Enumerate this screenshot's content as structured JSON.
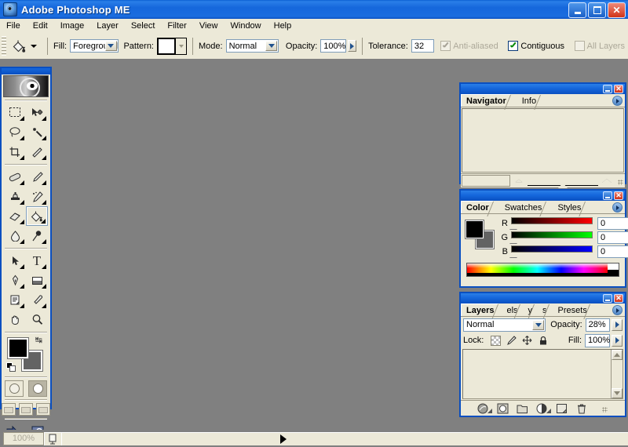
{
  "window": {
    "title": "Adobe Photoshop ME",
    "app_icon": "photoshop-icon",
    "buttons": {
      "minimize": "minimize-icon",
      "restore": "restore-icon",
      "close": "close-icon"
    }
  },
  "menubar": {
    "items": [
      "File",
      "Edit",
      "Image",
      "Layer",
      "Select",
      "Filter",
      "View",
      "Window",
      "Help"
    ]
  },
  "options_bar": {
    "tool_icon": "paint-bucket-icon",
    "tool_preset_caret": "chevron-down-icon",
    "fill_label": "Fill:",
    "fill_value": "Foreground",
    "pattern_label": "Pattern:",
    "pattern_swatch": "pattern-swatch",
    "mode_label": "Mode:",
    "mode_value": "Normal",
    "opacity_label": "Opacity:",
    "opacity_value": "100%",
    "tolerance_label": "Tolerance:",
    "tolerance_value": "32",
    "antialiased_label": "Anti-aliased",
    "antialiased_checked": true,
    "antialiased_enabled": false,
    "contiguous_label": "Contiguous",
    "contiguous_checked": true,
    "contiguous_enabled": true,
    "all_layers_label": "All Layers",
    "all_layers_checked": false,
    "all_layers_enabled": false
  },
  "toolbox": {
    "logo": "photoshop-eye-logo",
    "tools": [
      {
        "name": "marquee-tool",
        "glyph": "⬚",
        "has_flyout": true,
        "active": false
      },
      {
        "name": "move-tool",
        "glyph": "✥",
        "has_flyout": false,
        "active": false
      },
      {
        "name": "lasso-tool",
        "glyph": "○",
        "has_flyout": true,
        "active": false
      },
      {
        "name": "magic-wand-tool",
        "glyph": "✳",
        "has_flyout": false,
        "active": false
      },
      {
        "name": "crop-tool",
        "glyph": "⌗",
        "has_flyout": false,
        "active": false
      },
      {
        "name": "slice-tool",
        "glyph": "✂",
        "has_flyout": true,
        "active": false
      },
      {
        "name": "healing-brush-tool",
        "glyph": "⌀",
        "has_flyout": true,
        "active": false
      },
      {
        "name": "brush-tool",
        "glyph": "✒",
        "has_flyout": true,
        "active": false
      },
      {
        "name": "clone-stamp-tool",
        "glyph": "⚑",
        "has_flyout": true,
        "active": false
      },
      {
        "name": "history-brush-tool",
        "glyph": "✎",
        "has_flyout": true,
        "active": false
      },
      {
        "name": "eraser-tool",
        "glyph": "▱",
        "has_flyout": true,
        "active": false
      },
      {
        "name": "paint-bucket-tool",
        "glyph": "◢",
        "has_flyout": true,
        "active": true
      },
      {
        "name": "blur-tool",
        "glyph": "●",
        "has_flyout": true,
        "active": false
      },
      {
        "name": "dodge-tool",
        "glyph": "⚲",
        "has_flyout": true,
        "active": false
      },
      {
        "name": "path-selection-tool",
        "glyph": "➤",
        "has_flyout": true,
        "active": false
      },
      {
        "name": "type-tool",
        "glyph": "T",
        "has_flyout": true,
        "active": false
      },
      {
        "name": "pen-tool",
        "glyph": "✒",
        "has_flyout": true,
        "active": false
      },
      {
        "name": "shape-tool",
        "glyph": "▣",
        "has_flyout": true,
        "active": false
      },
      {
        "name": "notes-tool",
        "glyph": "☰",
        "has_flyout": true,
        "active": false
      },
      {
        "name": "eyedropper-tool",
        "glyph": "➘",
        "has_flyout": true,
        "active": false
      },
      {
        "name": "hand-tool",
        "glyph": "✋",
        "has_flyout": false,
        "active": false
      },
      {
        "name": "zoom-tool",
        "glyph": "⌕",
        "has_flyout": false,
        "active": false
      }
    ],
    "foreground_color": "#000000",
    "background_color": "#636363",
    "swap_colors_icon": "swap-colors-icon",
    "default_colors_icon": "default-colors-icon",
    "quick_mask": {
      "standard": "standard-mode-icon",
      "quickmask": "quick-mask-mode-icon",
      "selected": "quickmask"
    },
    "screen_modes": [
      "standard-screen-mode",
      "full-screen-menubar-mode",
      "full-screen-mode"
    ],
    "jump_buttons": [
      "jump-to-imageready-icon",
      "jump-to-preview-icon"
    ]
  },
  "navigator_palette": {
    "tabs": [
      {
        "label": "Navigator",
        "selected": true
      },
      {
        "label": "Info",
        "selected": false
      }
    ],
    "menu_icon": "palette-menu-icon",
    "zoom_value": "",
    "zoom_out_icon": "zoom-out-icon",
    "zoom_in_icon": "zoom-in-icon",
    "resize_grip": "resize-grip"
  },
  "color_palette": {
    "tabs": [
      {
        "label": "Color",
        "selected": true
      },
      {
        "label": "Swatches",
        "selected": false
      },
      {
        "label": "Styles",
        "selected": false
      }
    ],
    "menu_icon": "palette-menu-icon",
    "foreground_color": "#000000",
    "background_color": "#636363",
    "channels": [
      {
        "label": "R",
        "value": "0",
        "bar_from": "#000000",
        "bar_to": "#ff0000"
      },
      {
        "label": "G",
        "value": "0",
        "bar_from": "#000000",
        "bar_to": "#00ff00"
      },
      {
        "label": "B",
        "value": "0",
        "bar_from": "#000000",
        "bar_to": "#0000ff"
      }
    ],
    "spectrum": "color-spectrum-ramp"
  },
  "layers_palette": {
    "tabs": [
      {
        "label": "Layers",
        "selected": true
      },
      {
        "label": "els",
        "selected": false
      },
      {
        "label": "y",
        "selected": false
      },
      {
        "label": "s",
        "selected": false
      },
      {
        "label": "Presets",
        "selected": false
      }
    ],
    "menu_icon": "palette-menu-icon",
    "blend_mode": "Normal",
    "opacity_label": "Opacity:",
    "opacity_value": "28%",
    "lock_label": "Lock:",
    "lock_icons": [
      "lock-transparent-pixels-icon",
      "lock-image-pixels-icon",
      "lock-position-icon",
      "lock-all-icon"
    ],
    "fill_label": "Fill:",
    "fill_value": "100%",
    "footer_icons": [
      "layer-style-icon",
      "layer-mask-icon",
      "new-group-icon",
      "new-adjustment-layer-icon",
      "new-layer-icon",
      "delete-layer-icon"
    ],
    "scroll_up_icon": "scroll-up-icon",
    "scroll_down_icon": "scroll-down-icon",
    "resize_grip": "resize-grip"
  },
  "status_bar": {
    "zoom_value": "100%",
    "document_icon": "document-icon",
    "info_text": "",
    "expand_icon": "expand-arrow-icon"
  },
  "colors": {
    "titlebar_blue": "#1567dc",
    "palette_bg": "#ece9d8",
    "canvas_gray": "#808080",
    "border_blue": "#0a4fc0"
  }
}
